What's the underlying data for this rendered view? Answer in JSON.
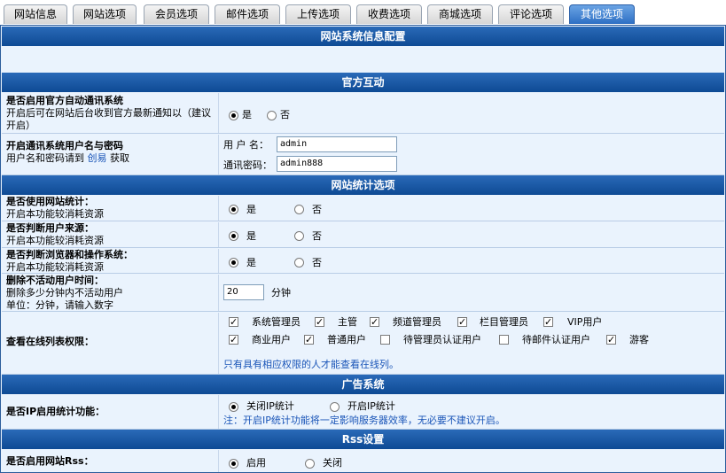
{
  "tabs": [
    {
      "label": "网站信息",
      "active": false
    },
    {
      "label": "网站选项",
      "active": false
    },
    {
      "label": "会员选项",
      "active": false
    },
    {
      "label": "邮件选项",
      "active": false
    },
    {
      "label": "上传选项",
      "active": false
    },
    {
      "label": "收费选项",
      "active": false
    },
    {
      "label": "商城选项",
      "active": false
    },
    {
      "label": "评论选项",
      "active": false
    },
    {
      "label": "其他选项",
      "active": true
    }
  ],
  "header_main": "网站系统信息配置",
  "section_official": "官方互动",
  "auto_comm": {
    "title": "是否启用官方自动通讯系统",
    "desc": "开启后可在网站后台收到官方最新通知以（建议开启）",
    "yes": "是",
    "no": "否",
    "selected": "yes"
  },
  "comm_account": {
    "title": "开启通讯系统用户名与密码",
    "desc_prefix": "用户名和密码请到",
    "link": "创易",
    "desc_suffix": "获取",
    "user_label": "用 户 名：",
    "user_value": "admin",
    "pass_label": "通讯密码：",
    "pass_value": "admin888"
  },
  "section_stats": "网站统计选项",
  "use_stats": {
    "title": "是否使用网站统计：",
    "desc": "开启本功能较消耗资源",
    "yes": "是",
    "no": "否",
    "selected": "yes"
  },
  "user_source": {
    "title": "是否判断用户来源：",
    "desc": "开启本功能较消耗资源",
    "yes": "是",
    "no": "否",
    "selected": "yes"
  },
  "browser_os": {
    "title": "是否判断浏览器和操作系统：",
    "desc": "开启本功能较消耗资源",
    "yes": "是",
    "no": "否",
    "selected": "yes"
  },
  "inactive_time": {
    "title": "删除不活动用户时间：",
    "desc1": "删除多少分钟内不活动用户",
    "desc2": "单位：分钟，请输入数字",
    "value": "20",
    "unit": "分钟"
  },
  "online_perm": {
    "title": "查看在线列表权限：",
    "options": [
      {
        "label": "系统管理员",
        "checked": true
      },
      {
        "label": "主管",
        "checked": true
      },
      {
        "label": "频道管理员",
        "checked": true
      },
      {
        "label": "栏目管理员",
        "checked": true
      },
      {
        "label": "VIP用户",
        "checked": true
      },
      {
        "label": "商业用户",
        "checked": true
      },
      {
        "label": "普通用户",
        "checked": true
      },
      {
        "label": "待管理员认证用户",
        "checked": false
      },
      {
        "label": "待邮件认证用户",
        "checked": false
      },
      {
        "label": "游客",
        "checked": true
      }
    ],
    "note": "只有具有相应权限的人才能查看在线列。"
  },
  "section_ads": "广告系统",
  "ip_stats": {
    "title": "是否IP启用统计功能：",
    "off": "关闭IP统计",
    "on": "开启IP统计",
    "selected": "off",
    "note": "注：开启IP统计功能将一定影响服务器效率，无必要不建议开启。"
  },
  "section_rss": "Rss设置",
  "rss": {
    "title": "是否启用网站Rss：",
    "enable": "启用",
    "disable": "关闭",
    "selected": "enable"
  }
}
